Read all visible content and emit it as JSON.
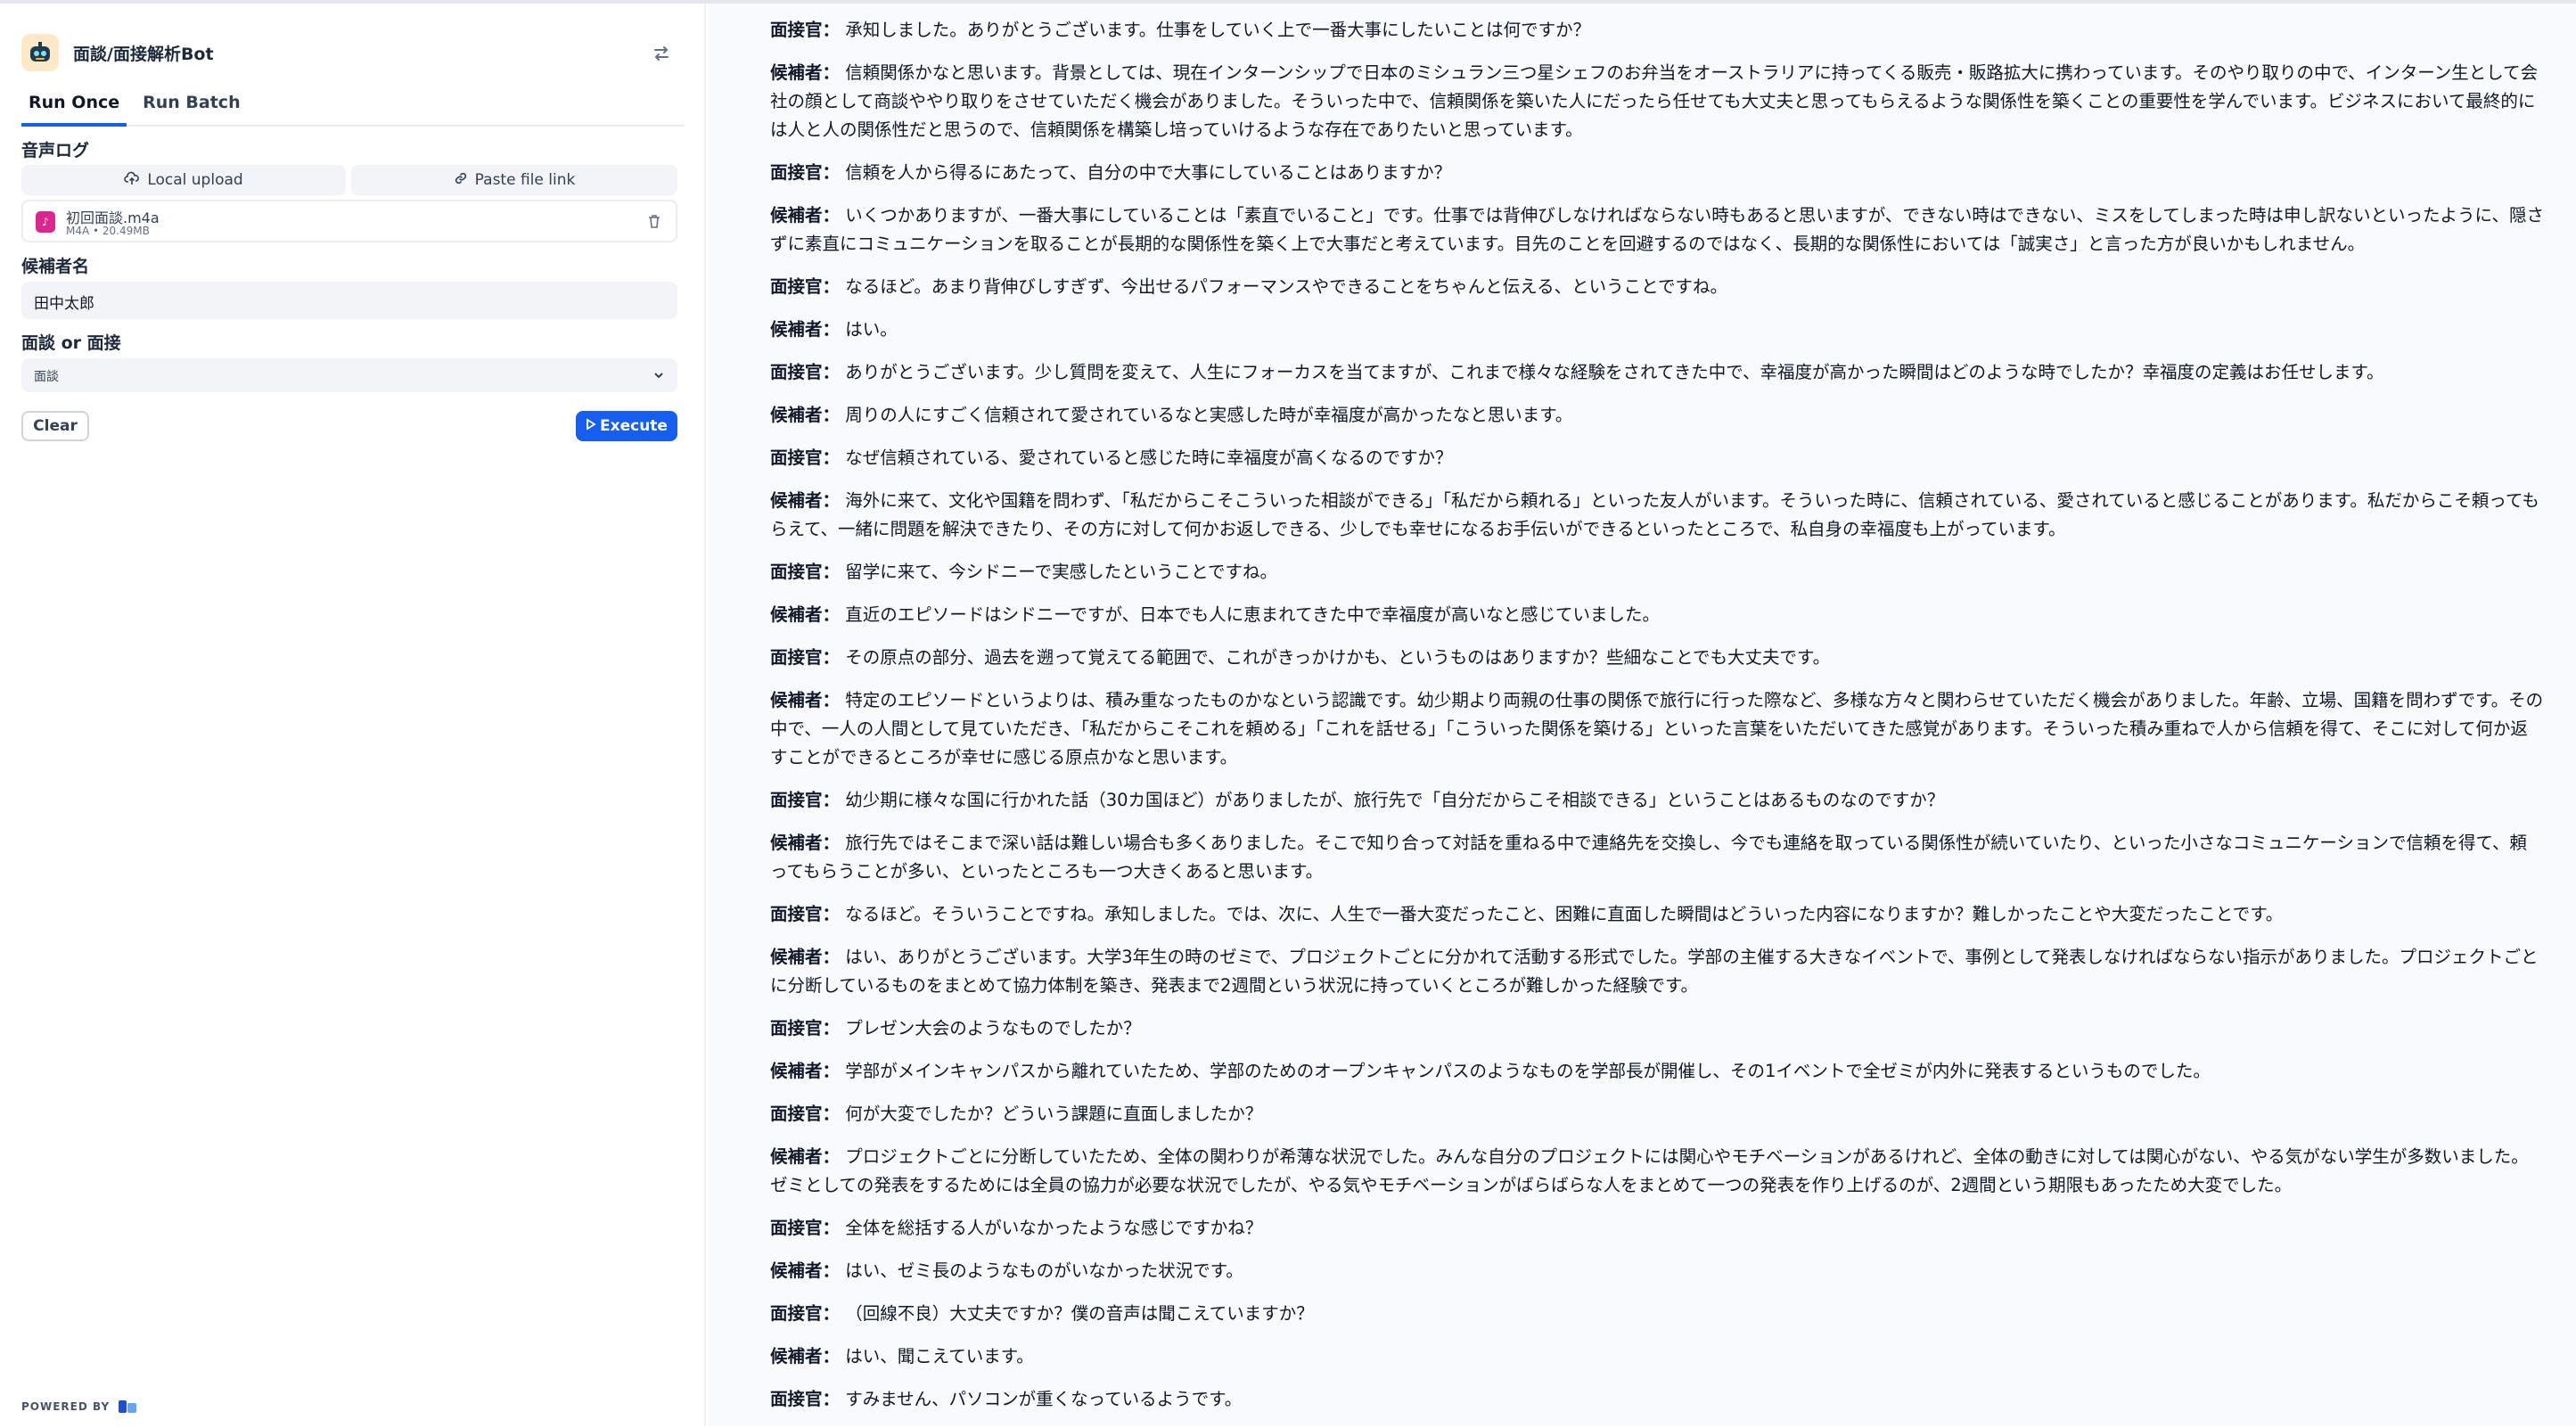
{
  "app": {
    "title": "面談/面接解析Bot"
  },
  "tabs": [
    {
      "label": "Run Once"
    },
    {
      "label": "Run Batch"
    }
  ],
  "form": {
    "audio_label": "音声ログ",
    "local_upload": "Local upload",
    "paste_link": "Paste file link",
    "file": {
      "name": "初回面談.m4a",
      "meta": "M4A • 20.49MB"
    },
    "candidate_label": "候補者名",
    "candidate_value": "田中太郎",
    "type_label": "面談 or 面接",
    "type_value": "面談",
    "clear": "Clear",
    "execute": "Execute"
  },
  "footer": {
    "powered_by": "POWERED BY"
  },
  "icons": [
    "robot-icon",
    "swap-icon",
    "cloud-upload-icon",
    "link-icon",
    "audio-file-icon",
    "trash-icon",
    "chevron-down-icon",
    "play-icon",
    "dify-logo-icon"
  ],
  "colors": {
    "accent": "#155eef",
    "file_icon": "#dd2590"
  },
  "transcript": [
    {
      "speaker": "面接官：",
      "text": "承知しました。ありがとうございます。仕事をしていく上で一番大事にしたいことは何ですか？"
    },
    {
      "speaker": "候補者：",
      "text": "信頼関係かなと思います。背景としては、現在インターンシップで日本のミシュラン三つ星シェフのお弁当をオーストラリアに持ってくる販売・販路拡大に携わっています。そのやり取りの中で、インターン生として会社の顔として商談ややり取りをさせていただく機会がありました。そういった中で、信頼関係を築いた人にだったら任せても大丈夫と思ってもらえるような関係性を築くことの重要性を学んでいます。ビジネスにおいて最終的には人と人の関係性だと思うので、信頼関係を構築し培っていけるような存在でありたいと思っています。"
    },
    {
      "speaker": "面接官：",
      "text": "信頼を人から得るにあたって、自分の中で大事にしていることはありますか？"
    },
    {
      "speaker": "候補者：",
      "text": "いくつかありますが、一番大事にしていることは「素直でいること」です。仕事では背伸びしなければならない時もあると思いますが、できない時はできない、ミスをしてしまった時は申し訳ないといったように、隠さずに素直にコミュニケーションを取ることが長期的な関係性を築く上で大事だと考えています。目先のことを回避するのではなく、長期的な関係性においては「誠実さ」と言った方が良いかもしれません。"
    },
    {
      "speaker": "面接官：",
      "text": "なるほど。あまり背伸びしすぎず、今出せるパフォーマンスやできることをちゃんと伝える、ということですね。"
    },
    {
      "speaker": "候補者：",
      "text": "はい。"
    },
    {
      "speaker": "面接官：",
      "text": "ありがとうございます。少し質問を変えて、人生にフォーカスを当てますが、これまで様々な経験をされてきた中で、幸福度が高かった瞬間はどのような時でしたか？幸福度の定義はお任せします。"
    },
    {
      "speaker": "候補者：",
      "text": "周りの人にすごく信頼されて愛されているなと実感した時が幸福度が高かったなと思います。"
    },
    {
      "speaker": "面接官：",
      "text": "なぜ信頼されている、愛されていると感じた時に幸福度が高くなるのですか？"
    },
    {
      "speaker": "候補者：",
      "text": "海外に来て、文化や国籍を問わず、「私だからこそこういった相談ができる」「私だから頼れる」といった友人がいます。そういった時に、信頼されている、愛されていると感じることがあります。私だからこそ頼ってもらえて、一緒に問題を解決できたり、その方に対して何かお返しできる、少しでも幸せになるお手伝いができるといったところで、私自身の幸福度も上がっています。"
    },
    {
      "speaker": "面接官：",
      "text": "留学に来て、今シドニーで実感したということですね。"
    },
    {
      "speaker": "候補者：",
      "text": "直近のエピソードはシドニーですが、日本でも人に恵まれてきた中で幸福度が高いなと感じていました。"
    },
    {
      "speaker": "面接官：",
      "text": "その原点の部分、過去を遡って覚えてる範囲で、これがきっかけかも、というものはありますか？些細なことでも大丈夫です。"
    },
    {
      "speaker": "候補者：",
      "text": "特定のエピソードというよりは、積み重なったものかなという認識です。幼少期より両親の仕事の関係で旅行に行った際など、多様な方々と関わらせていただく機会がありました。年齢、立場、国籍を問わずです。その中で、一人の人間として見ていただき、「私だからこそこれを頼める」「これを話せる」「こういった関係を築ける」といった言葉をいただいてきた感覚があります。そういった積み重ねで人から信頼を得て、そこに対して何か返すことができるところが幸せに感じる原点かなと思います。"
    },
    {
      "speaker": "面接官：",
      "text": "幼少期に様々な国に行かれた話（30カ国ほど）がありましたが、旅行先で「自分だからこそ相談できる」ということはあるものなのですか？"
    },
    {
      "speaker": "候補者：",
      "text": "旅行先ではそこまで深い話は難しい場合も多くありました。そこで知り合って対話を重ねる中で連絡先を交換し、今でも連絡を取っている関係性が続いていたり、といった小さなコミュニケーションで信頼を得て、頼ってもらうことが多い、といったところも一つ大きくあると思います。"
    },
    {
      "speaker": "面接官：",
      "text": "なるほど。そういうことですね。承知しました。では、次に、人生で一番大変だったこと、困難に直面した瞬間はどういった内容になりますか？難しかったことや大変だったことです。"
    },
    {
      "speaker": "候補者：",
      "text": "はい、ありがとうございます。大学3年生の時のゼミで、プロジェクトごとに分かれて活動する形式でした。学部の主催する大きなイベントで、事例として発表しなければならない指示がありました。プロジェクトごとに分断しているものをまとめて協力体制を築き、発表まで2週間という状況に持っていくところが難しかった経験です。"
    },
    {
      "speaker": "面接官：",
      "text": "プレゼン大会のようなものでしたか？"
    },
    {
      "speaker": "候補者：",
      "text": "学部がメインキャンパスから離れていたため、学部のためのオープンキャンパスのようなものを学部長が開催し、その1イベントで全ゼミが内外に発表するというものでした。"
    },
    {
      "speaker": "面接官：",
      "text": "何が大変でしたか？どういう課題に直面しましたか？"
    },
    {
      "speaker": "候補者：",
      "text": "プロジェクトごとに分断していたため、全体の関わりが希薄な状況でした。みんな自分のプロジェクトには関心やモチベーションがあるけれど、全体の動きに対しては関心がない、やる気がない学生が多数いました。ゼミとしての発表をするためには全員の協力が必要な状況でしたが、やる気やモチベーションがばらばらな人をまとめて一つの発表を作り上げるのが、2週間という期限もあったため大変でした。"
    },
    {
      "speaker": "面接官：",
      "text": "全体を総括する人がいなかったような感じですかね？"
    },
    {
      "speaker": "候補者：",
      "text": "はい、ゼミ長のようなものがいなかった状況です。"
    },
    {
      "speaker": "面接官：",
      "text": "（回線不良）大丈夫ですか？僕の音声は聞こえていますか？"
    },
    {
      "speaker": "候補者：",
      "text": "はい、聞こえています。"
    },
    {
      "speaker": "面接官：",
      "text": "すみません、パソコンが重くなっているようです。"
    }
  ]
}
